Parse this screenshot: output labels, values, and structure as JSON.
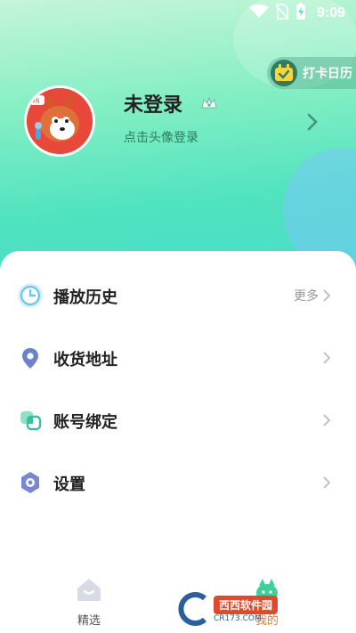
{
  "status_bar": {
    "time": "9:09",
    "icons": [
      "wifi-icon",
      "no-sim-icon",
      "battery-charging-icon"
    ]
  },
  "checkin": {
    "label": "打卡日历",
    "icon": "calendar-icon"
  },
  "profile": {
    "name": "未登录",
    "subtitle": "点击头像登录",
    "avatar_icon": "fox-avatar",
    "badge_icon": "level-badge-icon"
  },
  "menu": [
    {
      "label": "播放历史",
      "icon": "clock-icon",
      "more": "更多"
    },
    {
      "label": "收货地址",
      "icon": "location-pin-icon",
      "more": ""
    },
    {
      "label": "账号绑定",
      "icon": "link-icon",
      "more": ""
    },
    {
      "label": "设置",
      "icon": "settings-icon",
      "more": ""
    }
  ],
  "bottom_nav": {
    "tabs": [
      {
        "label": "精选",
        "icon": "home-icon"
      },
      {
        "label": "我的",
        "icon": "profile-icon"
      }
    ]
  },
  "watermark": {
    "brand": "西西软件园",
    "sub": "CR173.COM"
  },
  "colors": {
    "accent_green": "#4fe3c0",
    "text_dark": "#222222",
    "text_muted": "#999999"
  }
}
